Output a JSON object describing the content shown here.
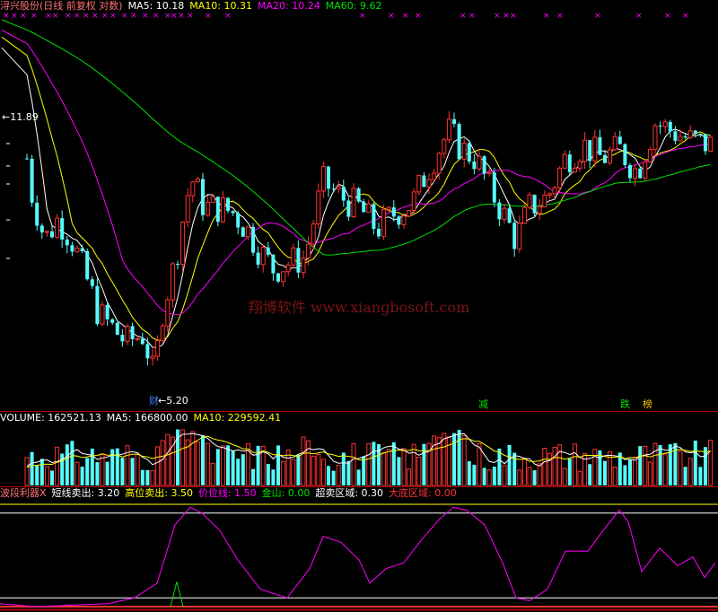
{
  "header": {
    "title": "浔兴股份(日线 前复权 对数)",
    "ma5": "MA5: 10.18",
    "ma10": "MA10: 10.31",
    "ma20": "MA20: 10.24",
    "ma60": "MA60: 9.62"
  },
  "volume_header": {
    "volume": "VOLUME: 162521.13",
    "ma5": "MA5: 166800.00",
    "ma10": "MA10: 229592.41"
  },
  "indicator_header": {
    "name": "波段利器X",
    "short_sell": "短线卖出: 3.20",
    "high_sell": "高位卖出: 3.50",
    "price_line": "价位线: 1.50",
    "gold": "金山: 0.00",
    "oversold": "超卖区域: 0.30",
    "big_bottom": "大底区域: 0.00"
  },
  "annotations": {
    "high_price": "11.89",
    "low_price": "5.20",
    "low_tag": "财",
    "tag_1": "减",
    "tag_2": "跌",
    "tag_3": "榜",
    "watermark": "翔博软件 www.xiangbosoft.com"
  },
  "colors": {
    "up": "#ff3232",
    "down": "#54fcfc",
    "ma5": "#ffffff",
    "ma10": "#ffff00",
    "ma20": "#ff00ff",
    "ma60": "#00e000",
    "frame": "#b40000"
  },
  "chart_data": [
    {
      "type": "candlestick",
      "title": "浔兴股份(日线 前复权 对数)",
      "annotated_high": 11.89,
      "annotated_low": 5.2,
      "last_ma_values": {
        "MA5": 10.18,
        "MA10": 10.31,
        "MA20": 10.24,
        "MA60": 9.62
      }
    },
    {
      "type": "bar",
      "title": "VOLUME",
      "last_values": {
        "VOLUME": 162521.13,
        "MA5": 166800.0,
        "MA10": 229592.41
      }
    },
    {
      "type": "line",
      "title": "波段利器X",
      "last_values": {
        "短线卖出": 3.2,
        "高位卖出": 3.5,
        "价位线": 1.5,
        "金山": 0.0,
        "超卖区域": 0.3,
        "大底区域": 0.0
      }
    }
  ]
}
